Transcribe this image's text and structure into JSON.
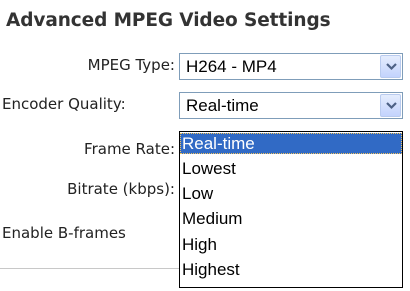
{
  "section": {
    "title": "Advanced MPEG Video Settings"
  },
  "fields": {
    "mpeg_type": {
      "label": "MPEG Type:",
      "value": "H264 - MP4"
    },
    "encoder_quality": {
      "label": "Encoder Quality:",
      "value": "Real-time",
      "options": [
        "Real-time",
        "Lowest",
        "Low",
        "Medium",
        "High",
        "Highest"
      ],
      "highlighted_option": "Real-time"
    },
    "frame_rate": {
      "label": "Frame Rate:"
    },
    "bitrate": {
      "label": "Bitrate (kbps):"
    },
    "b_frames": {
      "label": "Enable B-frames"
    }
  },
  "colors": {
    "highlight_bg": "#316ac5",
    "highlight_text": "#ffffff",
    "select_border": "#7f9db9",
    "arrow_color": "#4d6185"
  },
  "icons": {
    "dropdown_arrow": "chevron-down-icon"
  }
}
